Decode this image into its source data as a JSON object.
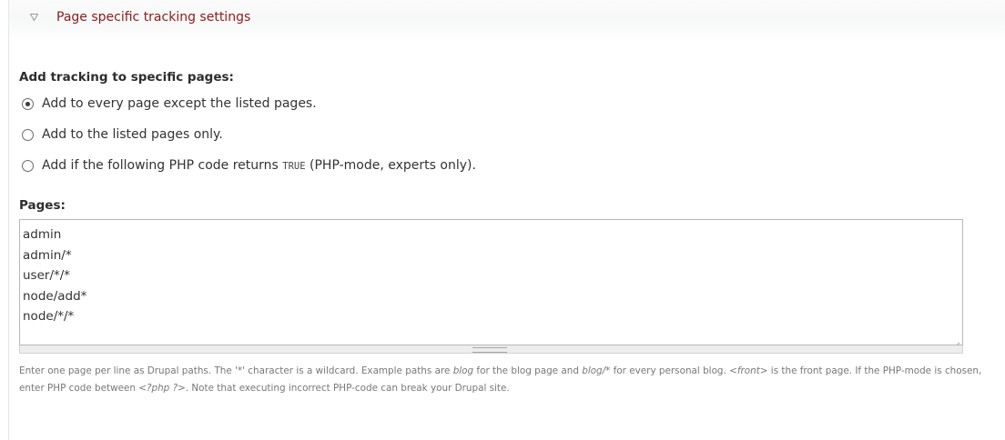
{
  "fieldset": {
    "legend": "Page specific tracking settings",
    "toggle_icon": "triangle-down-icon"
  },
  "visibility": {
    "label": "Add tracking to specific pages:",
    "options": [
      {
        "label": "Add to every page except the listed pages.",
        "checked": true
      },
      {
        "label": "Add to the listed pages only.",
        "checked": false
      },
      {
        "label_before": "Add if the following PHP code returns ",
        "code": "TRUE",
        "label_after": " (PHP-mode, experts only).",
        "checked": false
      }
    ]
  },
  "pages": {
    "label": "Pages:",
    "lines": [
      "admin",
      "admin/*",
      "user/*/*",
      "node/add*",
      "node/*/*"
    ],
    "description": {
      "p1": "Enter one page per line as Drupal paths. The '*' character is a wildcard. Example paths are ",
      "em1": "blog",
      "p2": " for the blog page and ",
      "em2": "blog/*",
      "p3": " for every personal blog. ",
      "em3": "<front>",
      "p4": " is the front page. If the PHP-mode is chosen, enter PHP code between ",
      "em4": "<?php ?>",
      "p5": ". Note that executing incorrect PHP-code can break your Drupal site."
    }
  }
}
